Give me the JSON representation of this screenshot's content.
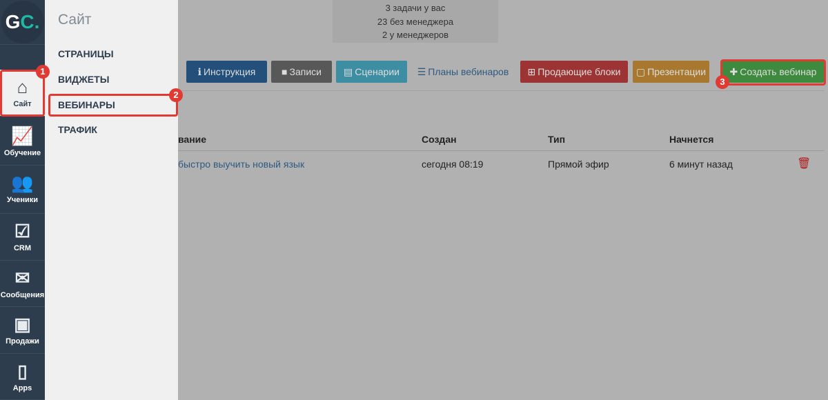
{
  "rail": {
    "logo": {
      "g": "G",
      "c": "C."
    },
    "items": [
      {
        "label": "Сайт",
        "icon": "house-icon",
        "glyph": "⌂"
      },
      {
        "label": "Обучение",
        "icon": "chart-board-icon",
        "glyph": "📈"
      },
      {
        "label": "Ученики",
        "icon": "users-icon",
        "glyph": "👥"
      },
      {
        "label": "CRM",
        "icon": "checkbox-icon",
        "glyph": "☑"
      },
      {
        "label": "Сообщения",
        "icon": "envelope-icon",
        "glyph": "✉"
      },
      {
        "label": "Продажи",
        "icon": "safe-icon",
        "glyph": "▣"
      },
      {
        "label": "Apps",
        "icon": "phone-icon",
        "glyph": "▯"
      }
    ]
  },
  "panel": {
    "title": "Сайт",
    "items": [
      "СТРАНИЦЫ",
      "ВИДЖЕТЫ",
      "ВЕБИНАРЫ",
      "ТРАФИК"
    ]
  },
  "badges": [
    "1",
    "2",
    "3"
  ],
  "tasks": [
    "3 задачи у вас",
    "23 без менеджера",
    "2 у менеджеров"
  ],
  "toolbar": [
    {
      "label": "Инструкция",
      "icon": "info-icon",
      "glyph": "ℹ",
      "color": "#22507a"
    },
    {
      "label": "Записи",
      "icon": "video-icon",
      "glyph": "■",
      "color": "#585858"
    },
    {
      "label": "Сценарии",
      "icon": "book-icon",
      "glyph": "▤",
      "color": "#3e8ea3"
    },
    {
      "label": "Планы вебинаров",
      "icon": "list-icon",
      "glyph": "☰",
      "color": "transparent"
    },
    {
      "label": "Продающие блоки",
      "icon": "grid-icon",
      "glyph": "⊞",
      "color": "#9c3434"
    },
    {
      "label": "Презентации",
      "icon": "file-icon",
      "glyph": "▢",
      "color": "#a8782f"
    },
    {
      "label": "Создать вебинар",
      "icon": "plus-icon",
      "glyph": "✚",
      "color": "#3e8a3e"
    }
  ],
  "table": {
    "headers": [
      "вание",
      "Создан",
      "Тип",
      "Начнется"
    ],
    "rows": [
      {
        "title": "быстро выучить новый язык",
        "created": "сегодня 08:19",
        "type": "Прямой эфир",
        "starts": "6 минут назад"
      }
    ]
  },
  "colors": {
    "highlight": "#e03a33",
    "link": "#2f5a80",
    "delete": "#b01c1c"
  }
}
